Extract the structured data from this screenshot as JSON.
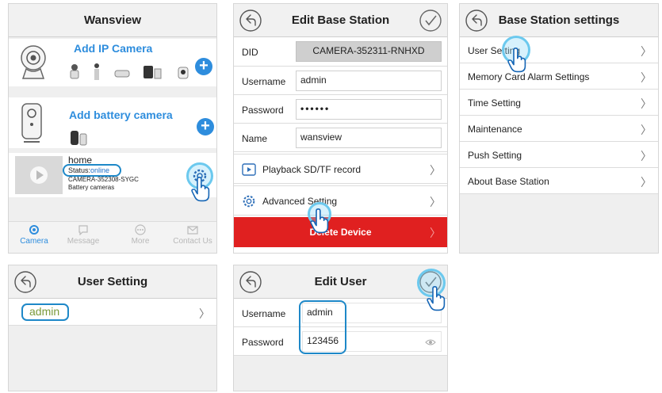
{
  "colors": {
    "accent": "#2e8ddd",
    "highlight": "#1e88c8",
    "delete_red": "#e02020",
    "status_online": "#1e6fc8"
  },
  "p1": {
    "title": "Wansview",
    "add_ip_label": "Add IP Camera",
    "add_battery_label": "Add battery camera",
    "device": {
      "name": "home",
      "status_label": "Status:",
      "status_value": "online",
      "did": "CAMERA-352308-SYGC",
      "type": "Battery cameras"
    },
    "tabs": [
      "Camera",
      "Message",
      "More",
      "Contact Us"
    ]
  },
  "p2": {
    "title": "Edit Base Station",
    "fields": [
      {
        "label": "DID",
        "value": "CAMERA-352311-RNHXD"
      },
      {
        "label": "Username",
        "value": "admin"
      },
      {
        "label": "Password",
        "value": "••••••"
      },
      {
        "label": "Name",
        "value": "wansview"
      }
    ],
    "playback_label": "Playback SD/TF record",
    "advanced_label": "Advanced Setting",
    "delete_label": "Delete Device"
  },
  "p3": {
    "title": "Base Station settings",
    "items": [
      "User Setting",
      "Memory Card Alarm Settings",
      "Time Setting",
      "Maintenance",
      "Push Setting",
      "About Base Station"
    ]
  },
  "p4": {
    "title": "User Setting",
    "user": "admin"
  },
  "p5": {
    "title": "Edit User",
    "username_label": "Username",
    "username_value": "admin",
    "password_label": "Password",
    "password_value": "123456"
  }
}
